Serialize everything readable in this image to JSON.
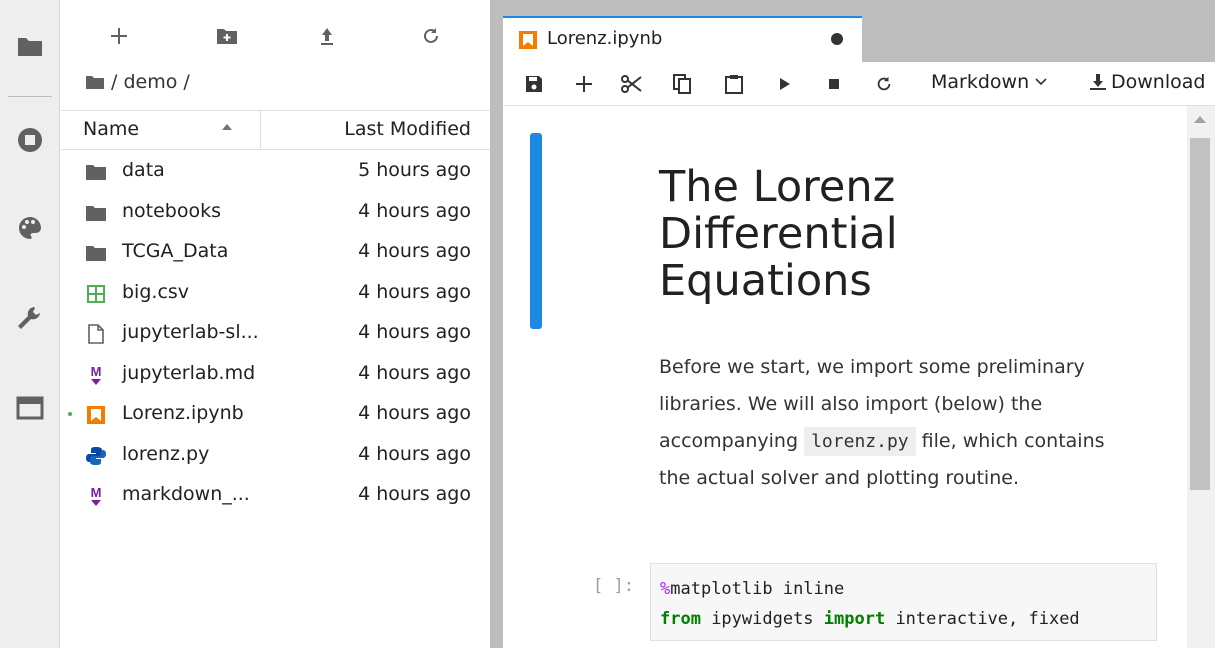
{
  "activity_bar": {
    "items": [
      {
        "icon": "folder-icon",
        "selected": true
      },
      {
        "icon": "running-stop-icon"
      },
      {
        "icon": "palette-icon"
      },
      {
        "icon": "wrench-icon"
      },
      {
        "icon": "tabs-icon"
      }
    ]
  },
  "file_browser": {
    "toolbar": [
      "new-launcher-icon",
      "new-folder-icon",
      "upload-icon",
      "refresh-icon"
    ],
    "breadcrumb": "/ demo /",
    "header": {
      "name": "Name",
      "last_modified": "Last Modified"
    },
    "files": [
      {
        "name": "data",
        "modified": "5 hours ago",
        "icon": "folder-icon"
      },
      {
        "name": "notebooks",
        "modified": "4 hours ago",
        "icon": "folder-icon"
      },
      {
        "name": "TCGA_Data",
        "modified": "4 hours ago",
        "icon": "folder-icon"
      },
      {
        "name": "big.csv",
        "modified": "4 hours ago",
        "icon": "spreadsheet-icon"
      },
      {
        "name": "jupyterlab-sl...",
        "modified": "4 hours ago",
        "icon": "file-icon"
      },
      {
        "name": "jupyterlab.md",
        "modified": "4 hours ago",
        "icon": "markdown-icon"
      },
      {
        "name": "Lorenz.ipynb",
        "modified": "4 hours ago",
        "icon": "notebook-icon",
        "running": true
      },
      {
        "name": "lorenz.py",
        "modified": "4 hours ago",
        "icon": "python-icon"
      },
      {
        "name": "markdown_...",
        "modified": "4 hours ago",
        "icon": "markdown-icon"
      }
    ]
  },
  "notebook": {
    "tab": {
      "title": "Lorenz.ipynb",
      "icon": "notebook-icon",
      "dirty": true
    },
    "toolbar": {
      "cell_type": "Markdown",
      "download": "Download"
    },
    "markdown_cell": {
      "heading": "The Lorenz Differential Equations",
      "para_before": "Before we start, we import some preliminary libraries. We will also import (below) the accompanying ",
      "code_inline": "lorenz.py",
      "para_after": " file, which contains the actual solver and plotting routine."
    },
    "code_cell": {
      "prompt": "[ ]:",
      "line1_magic": "%",
      "line1_rest": "matplotlib inline",
      "line2_from": "from",
      "line2_module": " ipywidgets ",
      "line2_import": "import",
      "line2_rest": " interactive, fixed"
    }
  },
  "colors": {
    "accent": "#1e88e5",
    "notebook_icon": "#f57c00",
    "markdown_icon": "#7b1fa2",
    "csv_icon": "#4caf50",
    "python_icon": "#0d47a1"
  }
}
